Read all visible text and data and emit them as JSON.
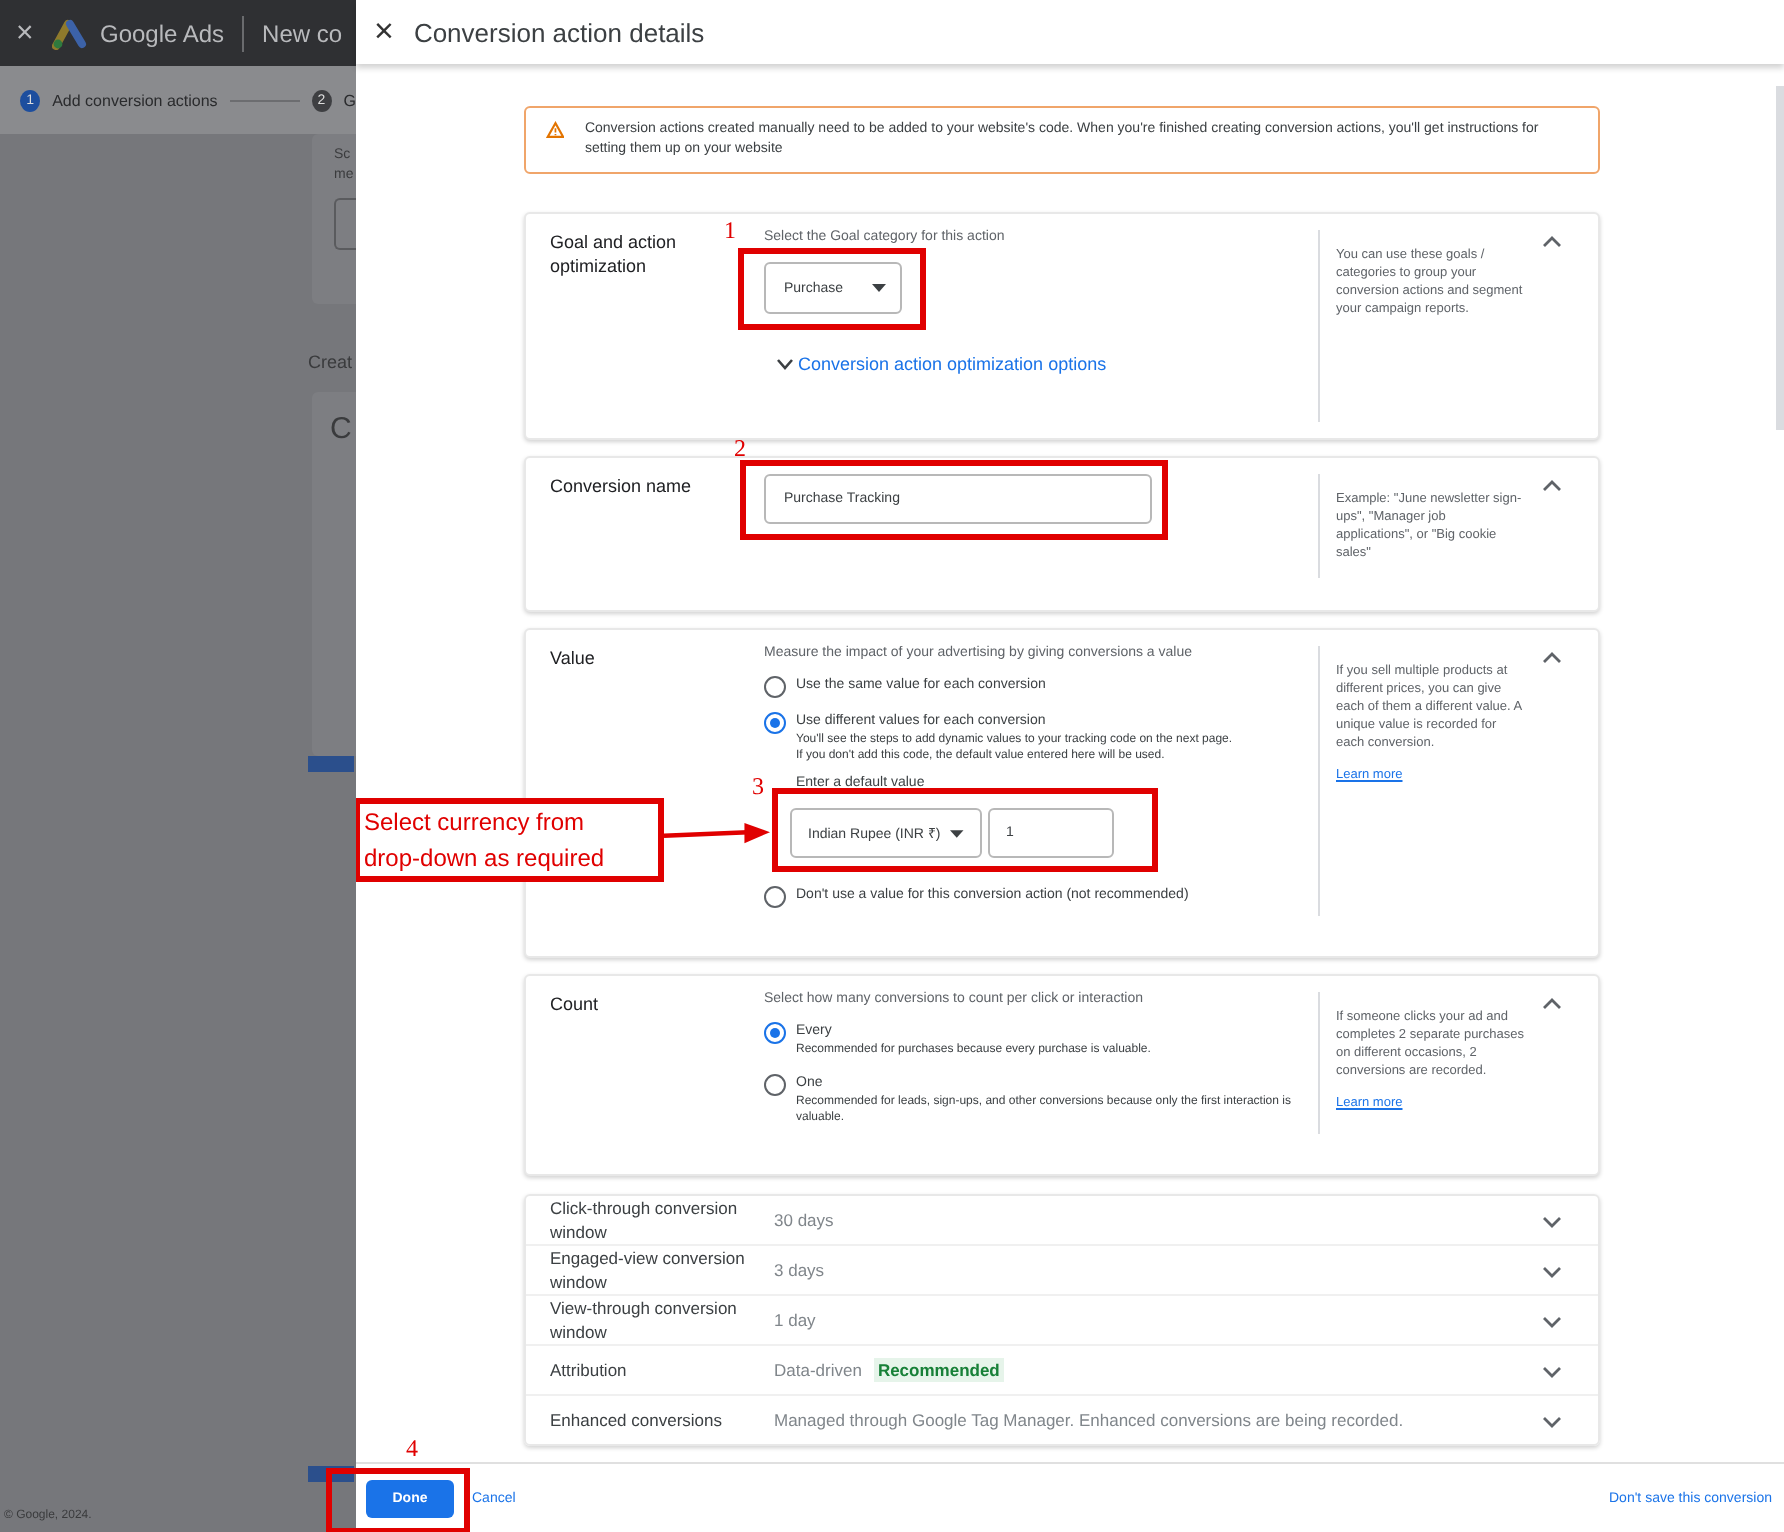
{
  "background_page": {
    "close": "×",
    "brand": "Google Ads",
    "page_title": "New co",
    "steps": [
      {
        "number": "1",
        "label": "Add conversion actions",
        "selected": true
      },
      {
        "number": "2",
        "label": "G",
        "selected": false
      }
    ],
    "card_lines": [
      "Sc",
      "me"
    ],
    "section_heading": "Creat",
    "card_heading": "C",
    "copyright": "© Google, 2024."
  },
  "dialog": {
    "close": "×",
    "title": "Conversion action details"
  },
  "notice": "Conversion actions created manually need to be added to your website's code. When you're finished creating conversion actions, you'll get instructions for setting them up on your website",
  "sections": [
    {
      "kind": "goal",
      "label": "Goal and action optimization",
      "expanded": true,
      "annotation": "1",
      "prompt": "Select the Goal category for this action",
      "dropdown": "Purchase",
      "link": "Conversion action optimization options",
      "help": "You can use these goals / categories to group your conversion actions and segment your campaign reports."
    },
    {
      "kind": "name",
      "label": "Conversion name",
      "expanded": true,
      "annotation": "2",
      "value": "Purchase Tracking",
      "help": "Example: \"June newsletter sign-ups\", \"Manager job applications\", or \"Big cookie sales\""
    },
    {
      "kind": "choice",
      "label": "Value",
      "expanded": true,
      "prompt": "Measure the impact of your advertising by giving conversions a value",
      "options": [
        {
          "label": "Use the same value for each conversion",
          "selected": false
        },
        {
          "label": "Use different values for each conversion",
          "selected": true,
          "description": "You'll see the steps to add dynamic values to your tracking code on the next page.\nIf you don't add this code, the default value entered here will be used.",
          "default_value": {
            "label": "Enter a default value",
            "currency": "Indian Rupee (INR ₹)",
            "amount": "1",
            "annotation": "3",
            "callout": "Select currency from drop-down as required"
          }
        },
        {
          "label": "Don't use a value for this conversion action (not recommended)",
          "selected": false
        }
      ],
      "help": "If you sell multiple products at different prices, you can give each of them a different value. A unique value is recorded for each conversion.",
      "learn_more": "Learn more"
    },
    {
      "kind": "choice",
      "label": "Count",
      "expanded": true,
      "prompt": "Select how many conversions to count per click or interaction",
      "options": [
        {
          "label": "Every",
          "selected": true,
          "description": "Recommended for purchases because every purchase is valuable."
        },
        {
          "label": "One",
          "selected": false,
          "description": "Recommended for leads, sign-ups, and other conversions because only the first interaction is valuable."
        }
      ],
      "help": "If someone clicks your ad and completes 2 separate purchases on different occasions, 2 conversions are recorded.",
      "learn_more": "Learn more"
    }
  ],
  "settings": [
    {
      "label": "Click-through conversion window",
      "value": "30 days",
      "expanded": false
    },
    {
      "label": "Engaged-view conversion window",
      "value": "3 days",
      "expanded": false
    },
    {
      "label": "View-through conversion window",
      "value": "1 day",
      "expanded": false
    },
    {
      "label": "Attribution",
      "value": "Data-driven",
      "badge": "Recommended",
      "expanded": false
    },
    {
      "label": "Enhanced conversions",
      "value": "Managed through Google Tag Manager. Enhanced conversions are being recorded.",
      "expanded": false
    }
  ],
  "footer": {
    "done": "Done",
    "annotation": "4",
    "cancel": "Cancel",
    "discard": "Don't save this conversion"
  }
}
